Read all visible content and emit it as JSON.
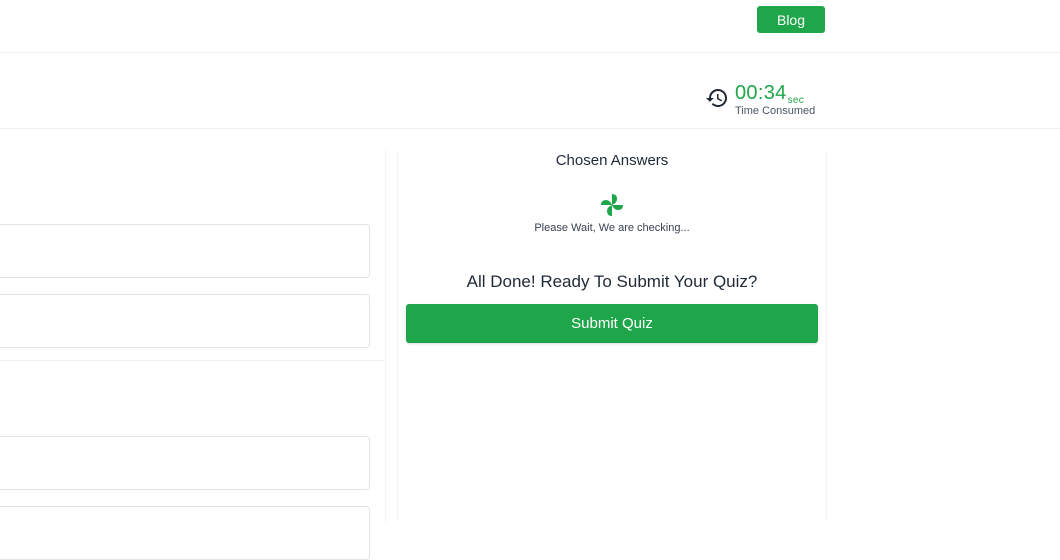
{
  "header": {
    "blog_label": "Blog"
  },
  "timer": {
    "value": "00:34",
    "unit": "sec",
    "label": "Time Consumed",
    "icon": "history-icon"
  },
  "results": {
    "title": "Chosen Answers",
    "loading_icon": "pinwheel-spinner-icon",
    "checking_text": "Please Wait, We are checking...",
    "ready_text": "All Done! Ready To Submit Your Quiz?",
    "submit_label": "Submit Quiz"
  },
  "colors": {
    "accent": "#1fa64a",
    "border": "#dfe3e8"
  }
}
